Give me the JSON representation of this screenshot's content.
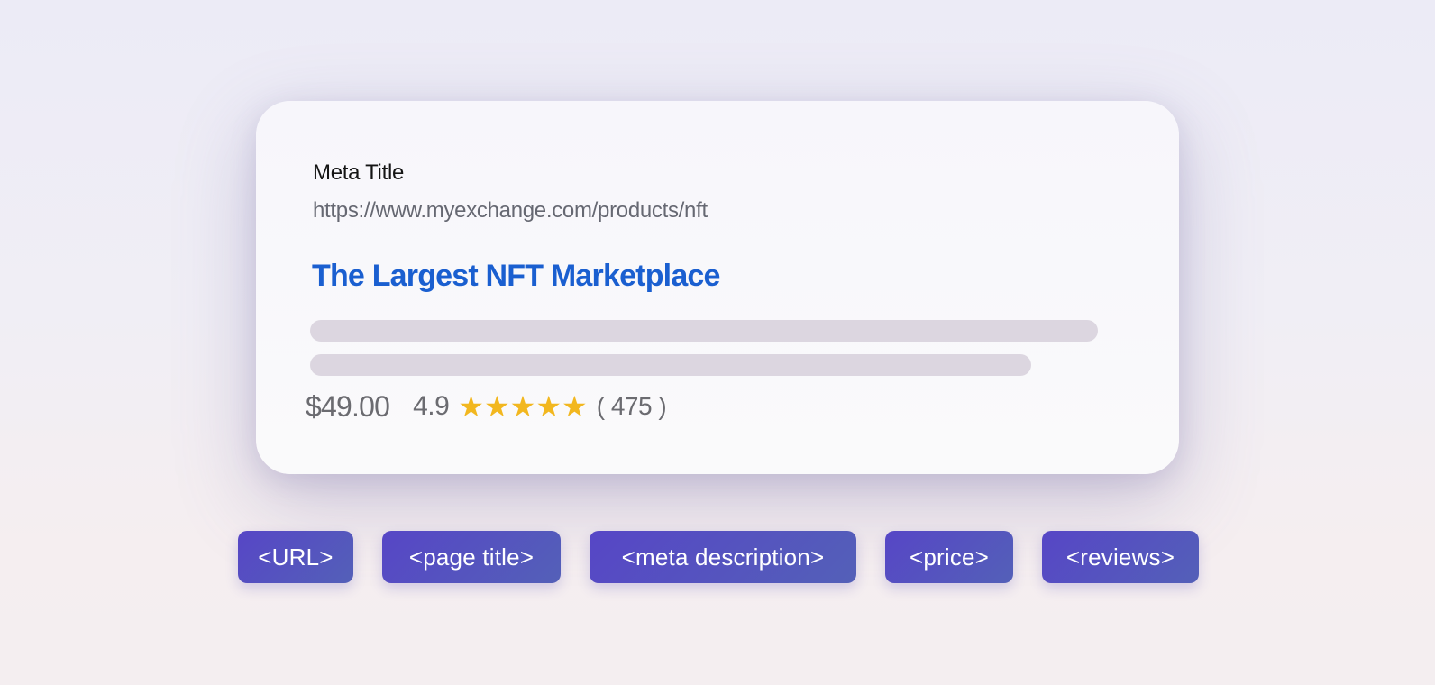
{
  "card": {
    "meta_title": "Meta Title",
    "url": "https://www.myexchange.com/products/nft",
    "page_title": "The Largest NFT Marketplace",
    "price": "$49.00",
    "rating": "4.9",
    "stars": 5,
    "star_glyph": "★",
    "review_count": "( 475 )",
    "description_lines": 2,
    "colors": {
      "title_blue": "#1a5fd0",
      "star_gold": "#f2b71f",
      "placeholder_bar": "#dcd6e0"
    }
  },
  "tags": {
    "url": "<URL>",
    "page_title": "<page title>",
    "meta_description": "<meta description>",
    "price": "<price>",
    "reviews": "<reviews>",
    "color": "#5646c6"
  }
}
